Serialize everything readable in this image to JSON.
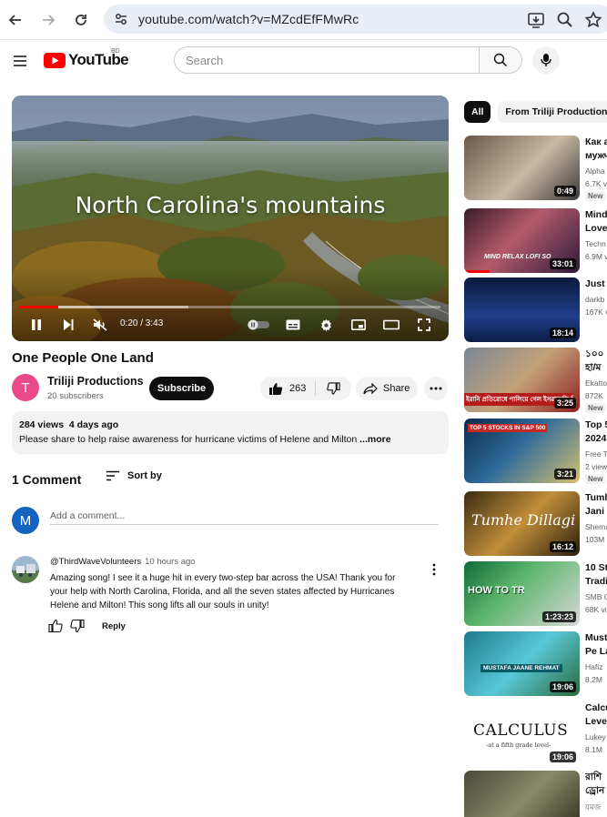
{
  "browser": {
    "url": "youtube.com/watch?v=MZcdEfFMwRc"
  },
  "header": {
    "logo_text": "YouTube",
    "region": "BD",
    "search_placeholder": "Search"
  },
  "player": {
    "caption": "North Carolina's mountains",
    "time": "0:20 / 3:43",
    "progress_fraction": 0.09
  },
  "video": {
    "title": "One People One Land",
    "channel_initial": "T",
    "channel_name": "Triliji Productions",
    "subscribers": "20 subscribers",
    "subscribe_label": "Subscribe",
    "likes": "263",
    "share_label": "Share",
    "views_date": "284 views  4 days ago",
    "description": "Please share to help raise awareness for hurricane victims of Helene and Milton",
    "more_label": " ...more"
  },
  "comments": {
    "count_label": "1 Comment",
    "sort_label": "Sort by",
    "my_initial": "M",
    "add_placeholder": "Add a comment...",
    "items": [
      {
        "author": "@ThirdWaveVolunteers",
        "time": "10 hours ago",
        "text": "Amazing song! I see it a huge hit in every two-step bar across the USA! Thank you for your help with North Carolina, Florida, and all the seven states affected by Hurricanes Helene and Milton! This song lifts all our souls in unity!",
        "reply_label": "Reply"
      }
    ]
  },
  "chips": [
    "All",
    "From Triliji Productions"
  ],
  "recommendations": [
    {
      "title": "Как а",
      "title2": "мужч",
      "channel": "Alpha",
      "views": "6.7K v",
      "duration": "0:49",
      "badge": "New"
    },
    {
      "title": "Mind",
      "title2": "Love",
      "channel": "Techn",
      "views": "6.9M v",
      "duration": "33:01",
      "badge": "",
      "thumb_text": "MIND RELAX LOFI SO"
    },
    {
      "title": "Just",
      "title2": "",
      "channel": "darkb",
      "views": "167K v",
      "duration": "18:14",
      "badge": ""
    },
    {
      "title": "১০০",
      "title2": "হা/ম",
      "channel": "Ekatto",
      "views": "872K",
      "duration": "3:25",
      "badge": "New",
      "thumb_text": "ইরানি প্রতিরোধে পালিয়ে গেল ইসরায়েলি বি"
    },
    {
      "title": "Top 5",
      "title2": "2024",
      "channel": "Free T",
      "views": "2 view",
      "duration": "3:21",
      "badge": "New",
      "thumb_text": "TOP 5 STOCKS IN S&P 500"
    },
    {
      "title": "Tumh",
      "title2": "Jani",
      "channel": "Shema",
      "views": "103M",
      "duration": "16:12",
      "badge": "",
      "thumb_text": "Tumhe Dillagi"
    },
    {
      "title": "10 St",
      "title2": "Tradi",
      "channel": "SMB C",
      "views": "68K vi",
      "duration": "1:23:23",
      "badge": "",
      "thumb_text": "HOW TO TRADE FOR A LIVING"
    },
    {
      "title": "Must",
      "title2": "Pe La",
      "channel": "Hafiz",
      "views": "8.2M",
      "duration": "19:06",
      "badge": "",
      "thumb_text": "MUSTAFA JAANE REHMAT"
    },
    {
      "title": "Calcu",
      "title2": "Level",
      "channel": "Lukey",
      "views": "8.1M",
      "duration": "19:06",
      "badge": "",
      "thumb_text": "CALCULUS",
      "thumb_sub": "-at a fifth grade level-"
    },
    {
      "title": "রাশি",
      "title2": "ড্রোন",
      "channel": "যমজ",
      "views": "",
      "duration": "",
      "badge": ""
    }
  ],
  "colors": {
    "brand_red": "#ff0000",
    "channel_avatar": "#e94a8a",
    "user_avatar": "#1565c0"
  }
}
